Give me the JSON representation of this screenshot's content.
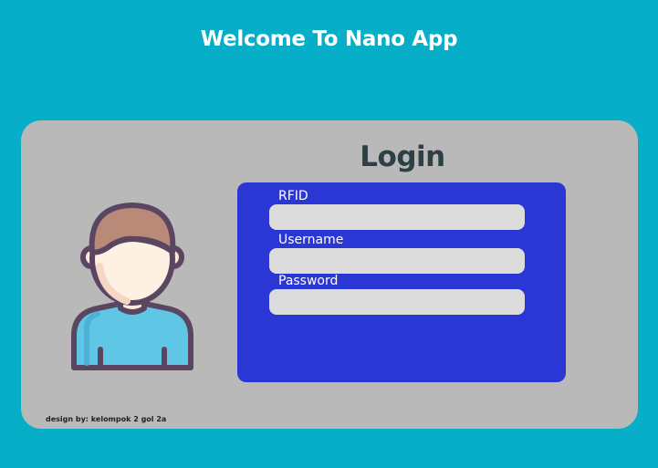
{
  "header": {
    "title": "Welcome To Nano App"
  },
  "login": {
    "title": "Login",
    "fields": [
      {
        "label": "RFID",
        "value": ""
      },
      {
        "label": "Username",
        "value": ""
      },
      {
        "label": "Password",
        "value": ""
      }
    ]
  },
  "footer": {
    "credit": "design by: kelompok 2 gol 2a"
  },
  "colors": {
    "background": "#06aec7",
    "card": "#b9b9b9",
    "form_panel": "#2a37d4",
    "input": "#dcdcdc",
    "login_title": "#2f3f46"
  },
  "icons": {
    "avatar": "user-avatar-icon"
  }
}
